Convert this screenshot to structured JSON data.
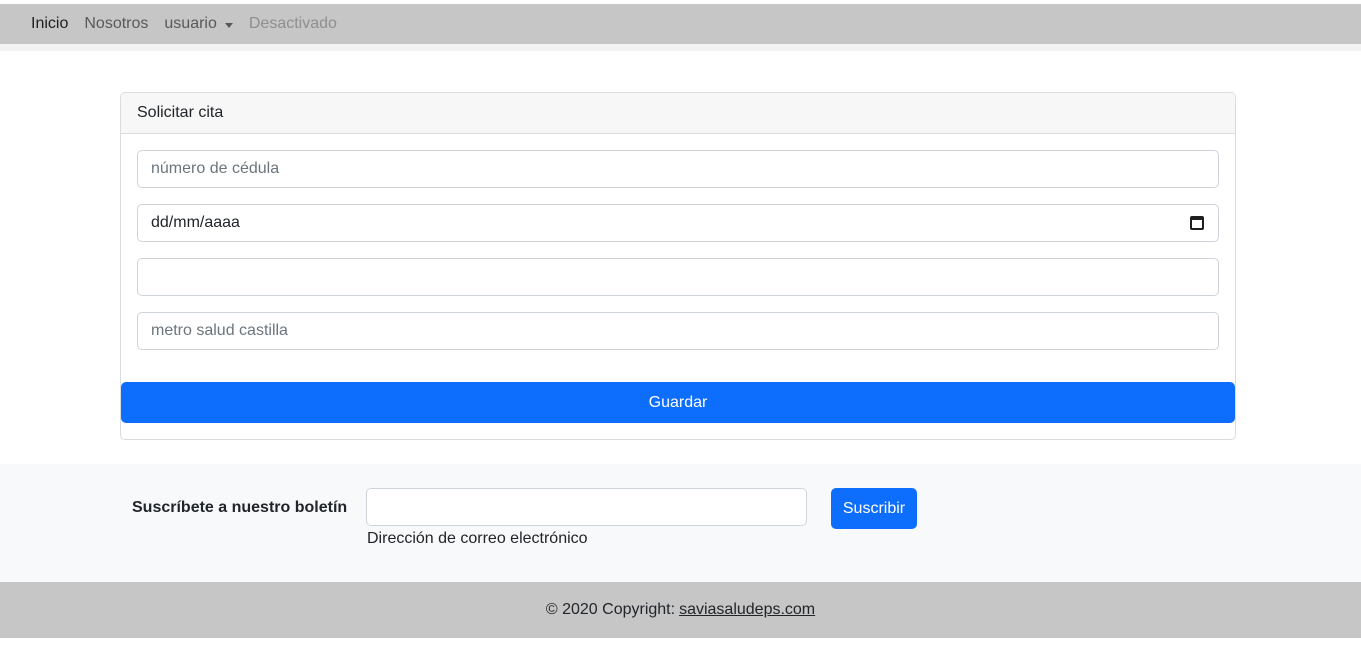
{
  "navbar": {
    "items": [
      {
        "label": "Inicio",
        "state": "active"
      },
      {
        "label": "Nosotros",
        "state": "normal"
      },
      {
        "label": "usuario",
        "state": "dropdown"
      },
      {
        "label": "Desactivado",
        "state": "disabled"
      }
    ]
  },
  "form": {
    "title": "Solicitar cita",
    "cedula_placeholder": "número de cédula",
    "date_value": "dd/mm/aaaa",
    "field3_value": "",
    "location_placeholder": "metro salud castilla",
    "submit_label": "Guardar",
    "icons": {
      "date": "calendar-icon"
    }
  },
  "newsletter": {
    "label": "Suscríbete a nuestro boletín",
    "email_value": "",
    "help_text": "Dirección de correo electrónico",
    "button_label": "Suscribir"
  },
  "footer": {
    "copyright_text": "© 2020 Copyright:",
    "link_text": "saviasaludeps.com"
  },
  "colors": {
    "navbar_bg": "#c6c6c6",
    "primary": "#0d6efd",
    "newsletter_bg": "#f8f9fa",
    "footer_bg": "#c6c6c6"
  }
}
